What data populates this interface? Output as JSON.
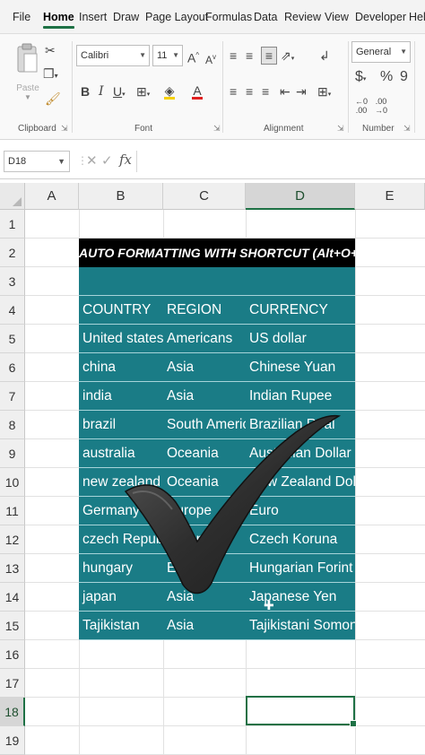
{
  "menu": {
    "tabs": [
      "File",
      "Home",
      "Insert",
      "Draw",
      "Page Layout",
      "Formulas",
      "Data",
      "Review",
      "View",
      "Developer",
      "Help"
    ],
    "active": "Home"
  },
  "ribbon": {
    "clipboard": {
      "label": "Clipboard",
      "paste_label": "Paste"
    },
    "font": {
      "label": "Font",
      "font_name": "Calibri",
      "font_size": "11",
      "bold": "B",
      "italic": "I",
      "underline": "U",
      "grow": "A",
      "shrink": "A"
    },
    "alignment": {
      "label": "Alignment"
    },
    "number": {
      "label": "Number",
      "format": "General",
      "currency": "$",
      "percent": "%",
      "comma": "9"
    }
  },
  "formula_bar": {
    "name_box": "D18",
    "fx": "fx",
    "content": ""
  },
  "columns": [
    "A",
    "B",
    "C",
    "D",
    "E"
  ],
  "selected_column": "D",
  "rows": [
    "1",
    "2",
    "3",
    "4",
    "5",
    "6",
    "7",
    "8",
    "9",
    "10",
    "11",
    "12",
    "13",
    "14",
    "15",
    "16",
    "17",
    "18",
    "19"
  ],
  "selected_row": "18",
  "sheet": {
    "title": "AUTO FORMATTING WITH SHORTCUT (Alt+O+A)",
    "headers": [
      "COUNTRY",
      "REGION",
      "CURRENCY"
    ],
    "data": [
      [
        "United states",
        "Americans",
        "US dollar"
      ],
      [
        "china",
        "Asia",
        "Chinese Yuan"
      ],
      [
        "india",
        "Asia",
        "Indian Rupee"
      ],
      [
        "brazil",
        "South America",
        "Brazilian Real"
      ],
      [
        "australia",
        "Oceania",
        "Australian Dollar"
      ],
      [
        "new zealand",
        "Oceania",
        "New Zealand Dollar"
      ],
      [
        "Germany",
        "Europe",
        "Euro"
      ],
      [
        "czech Republic",
        "Europe",
        "Czech Koruna"
      ],
      [
        "hungary",
        "Europe",
        "Hungarian Forint"
      ],
      [
        "japan",
        "Asia",
        "Japanese Yen"
      ],
      [
        "Tajikistan",
        "Asia",
        "Tajikistani Somoni"
      ]
    ]
  },
  "colors": {
    "accent": "#1e7145",
    "table_fill": "#1a7c86",
    "title_fill": "#000000"
  }
}
